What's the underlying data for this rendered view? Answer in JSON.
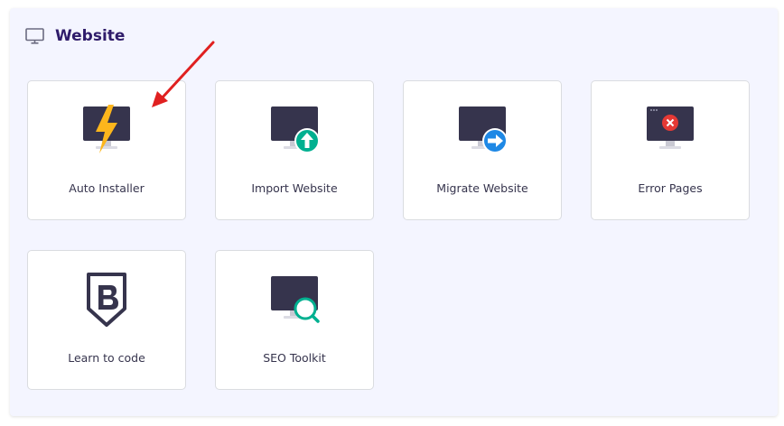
{
  "section": {
    "title": "Website",
    "icon": "monitor-icon"
  },
  "cards": [
    {
      "label": "Auto Installer",
      "icon": "lightning-monitor-icon"
    },
    {
      "label": "Import Website",
      "icon": "monitor-upload-icon"
    },
    {
      "label": "Migrate Website",
      "icon": "monitor-arrow-right-icon"
    },
    {
      "label": "Error Pages",
      "icon": "monitor-error-icon"
    },
    {
      "label": "Learn to code",
      "icon": "bootstrap-shield-icon"
    },
    {
      "label": "SEO Toolkit",
      "icon": "monitor-search-icon"
    }
  ],
  "colors": {
    "panel_bg": "#f4f5ff",
    "title": "#2f1c6a",
    "monitor": "#36344d",
    "lightning": "#fdb61c",
    "upload": "#00b090",
    "migrate": "#1e88e5",
    "error": "#e53935",
    "annotation_arrow": "#e02020"
  }
}
